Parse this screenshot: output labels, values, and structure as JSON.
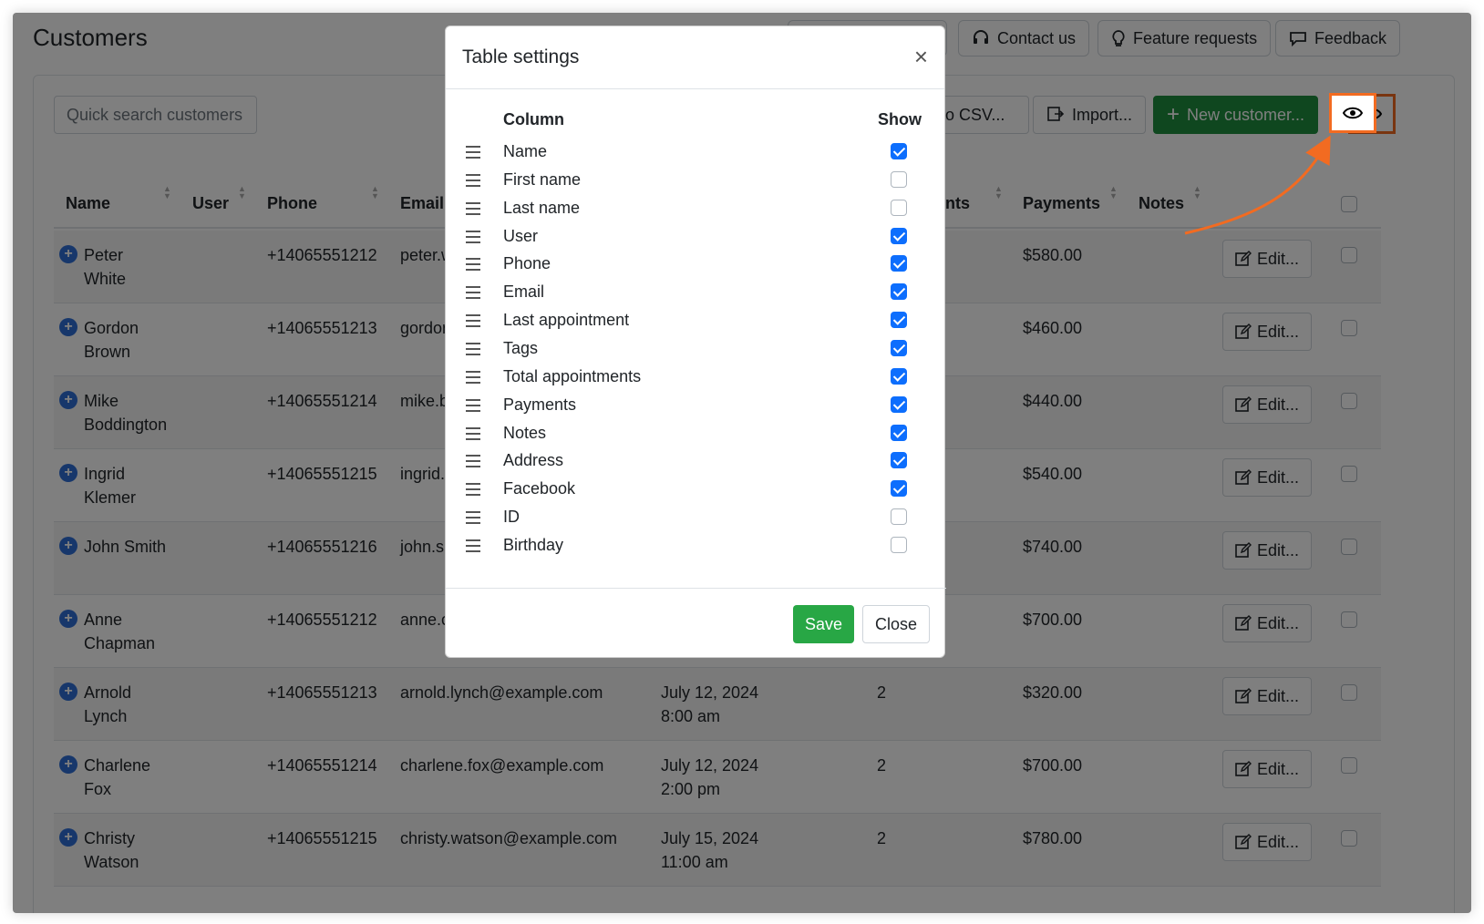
{
  "page": {
    "title": "Customers"
  },
  "header_buttons": {
    "contact": "Contact us",
    "features": "Feature requests",
    "feedback": "Feedback"
  },
  "toolbar": {
    "search_placeholder": "Quick search customers",
    "export_label": "to CSV...",
    "import_label": "Import...",
    "new_customer_label": "New customer..."
  },
  "table": {
    "headers": {
      "name": "Name",
      "user": "User",
      "phone": "Phone",
      "email": "Email",
      "appointments": "ents",
      "payments": "Payments",
      "notes": "Notes"
    },
    "edit_label": "Edit...",
    "rows": [
      {
        "first": "Peter",
        "last": "White",
        "phone": "+14065551212",
        "email": "peter.w",
        "date": "",
        "time": "",
        "count": "",
        "payment": "$580.00"
      },
      {
        "first": "Gordon",
        "last": "Brown",
        "phone": "+14065551213",
        "email": "gordon",
        "date": "",
        "time": "",
        "count": "",
        "payment": "$460.00"
      },
      {
        "first": "Mike",
        "last": "Boddington",
        "phone": "+14065551214",
        "email": "mike.b",
        "date": "",
        "time": "",
        "count": "",
        "payment": "$440.00"
      },
      {
        "first": "Ingrid",
        "last": "Klemer",
        "phone": "+14065551215",
        "email": "ingrid.",
        "date": "",
        "time": "",
        "count": "",
        "payment": "$540.00"
      },
      {
        "first": "John Smith",
        "last": "",
        "phone": "+14065551216",
        "email": "john.sr",
        "date": "",
        "time": "",
        "count": "",
        "payment": "$740.00"
      },
      {
        "first": "Anne",
        "last": "Chapman",
        "phone": "+14065551212",
        "email": "anne.c",
        "date": "",
        "time": "",
        "count": "",
        "payment": "$700.00"
      },
      {
        "first": "Arnold",
        "last": "Lynch",
        "phone": "+14065551213",
        "email": "arnold.lynch@example.com",
        "date": "July 12, 2024",
        "time": "8:00 am",
        "count": "2",
        "payment": "$320.00"
      },
      {
        "first": "Charlene",
        "last": "Fox",
        "phone": "+14065551214",
        "email": "charlene.fox@example.com",
        "date": "July 12, 2024",
        "time": "2:00 pm",
        "count": "2",
        "payment": "$700.00"
      },
      {
        "first": "Christy",
        "last": "Watson",
        "phone": "+14065551215",
        "email": "christy.watson@example.com",
        "date": "July 15, 2024",
        "time": "11:00 am",
        "count": "2",
        "payment": "$780.00"
      }
    ]
  },
  "modal": {
    "title": "Table settings",
    "close_icon": "×",
    "column_header": "Column",
    "show_header": "Show",
    "save_label": "Save",
    "close_label": "Close",
    "columns": [
      {
        "label": "Name",
        "show": true
      },
      {
        "label": "First name",
        "show": false
      },
      {
        "label": "Last name",
        "show": false
      },
      {
        "label": "User",
        "show": true
      },
      {
        "label": "Phone",
        "show": true
      },
      {
        "label": "Email",
        "show": true
      },
      {
        "label": "Last appointment",
        "show": true
      },
      {
        "label": "Tags",
        "show": true
      },
      {
        "label": "Total appointments",
        "show": true
      },
      {
        "label": "Payments",
        "show": true
      },
      {
        "label": "Notes",
        "show": true
      },
      {
        "label": "Address",
        "show": true
      },
      {
        "label": "Facebook",
        "show": true
      },
      {
        "label": "ID",
        "show": false
      },
      {
        "label": "Birthday",
        "show": false
      }
    ]
  },
  "colors": {
    "accent": "#f26b21",
    "primary": "#0d6efd",
    "success": "#28a745",
    "new_customer": "#1e8e3e"
  }
}
